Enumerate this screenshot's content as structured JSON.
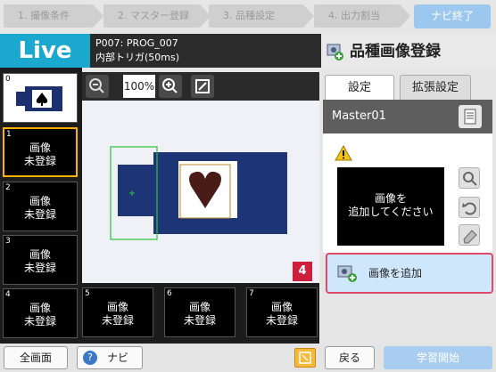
{
  "steps": [
    "1. 撮像条件",
    "2. マスター登録",
    "3. 品種設定",
    "4. 出力割当"
  ],
  "navi_end": "ナビ終了",
  "live": {
    "label": "Live",
    "program": "P007: PROG_007",
    "trigger": "内部トリガ(50ms)"
  },
  "toolbar": {
    "zoom": "100%"
  },
  "thumbnails": [
    {
      "index": "0",
      "label": ""
    },
    {
      "index": "1",
      "label": "画像\n未登録"
    },
    {
      "index": "2",
      "label": "画像\n未登録"
    },
    {
      "index": "3",
      "label": "画像\n未登録"
    },
    {
      "index": "4",
      "label": "画像\n未登録"
    },
    {
      "index": "5",
      "label": "画像\n未登録"
    },
    {
      "index": "6",
      "label": "画像\n未登録"
    },
    {
      "index": "7",
      "label": "画像\n未登録"
    }
  ],
  "bottom_bar": {
    "fullscreen": "全画面",
    "navi": "ナビ"
  },
  "panel": {
    "title": "品種画像登録",
    "tab_settings": "設定",
    "tab_extended": "拡張設定",
    "master_name": "Master01",
    "preview_text": "画像を\n追加してください",
    "add_image": "画像を追加",
    "step_number": "4",
    "back": "戻る",
    "learn_start": "学習開始"
  },
  "colors": {
    "live_accent": "#1aa8cf",
    "highlight": "#e04a6a",
    "step_badge": "#cc1f3b",
    "selected_thumb": "#ffb000"
  }
}
